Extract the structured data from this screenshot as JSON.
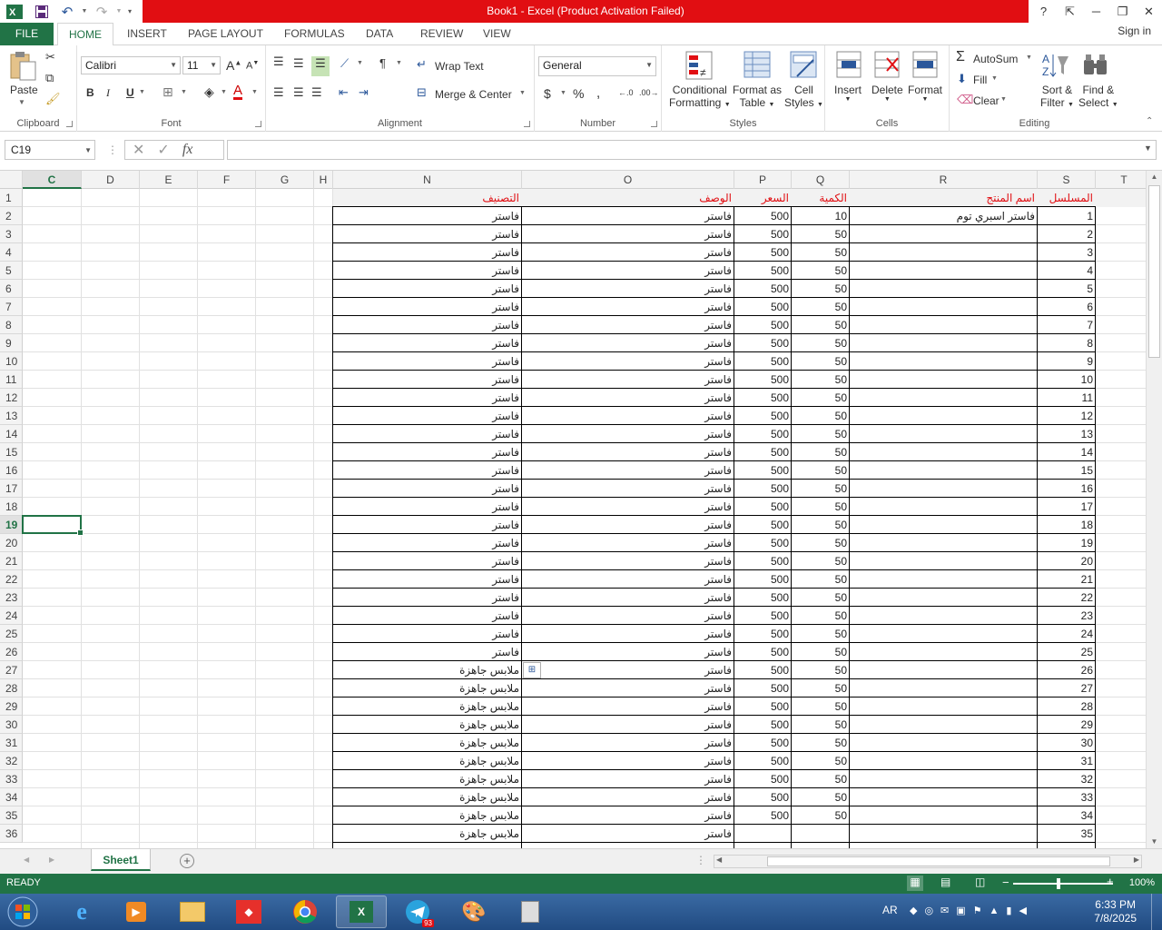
{
  "titlebar": {
    "title": "Book1 -  Excel (Product Activation Failed)",
    "help": "?"
  },
  "ribbon_tabs": {
    "file": "FILE",
    "tabs": [
      "HOME",
      "INSERT",
      "PAGE LAYOUT",
      "FORMULAS",
      "DATA",
      "REVIEW",
      "VIEW"
    ],
    "signin": "Sign in"
  },
  "ribbon": {
    "clipboard": {
      "paste": "Paste",
      "label": "Clipboard"
    },
    "font": {
      "name": "Calibri",
      "size": "11",
      "label": "Font",
      "bold": "B",
      "italic": "I",
      "underline": "U",
      "grow": "A",
      "shrink": "A"
    },
    "alignment": {
      "wrap_text": "Wrap Text",
      "merge_center": "Merge & Center",
      "label": "Alignment"
    },
    "number": {
      "format": "General",
      "currency": "$",
      "percent": "%",
      "comma": ",",
      "label": "Number"
    },
    "styles": {
      "conditional": "Conditional",
      "formatting": "Formatting",
      "format_as": "Format as",
      "table": "Table",
      "cell": "Cell",
      "cell_styles": "Styles",
      "label": "Styles"
    },
    "cells": {
      "insert": "Insert",
      "delete": "Delete",
      "format": "Format",
      "label": "Cells"
    },
    "editing": {
      "autosum": "AutoSum",
      "fill": "Fill",
      "clear": "Clear",
      "sort": "Sort &",
      "filter": "Filter",
      "find": "Find &",
      "select": "Select",
      "label": "Editing"
    }
  },
  "formula_bar": {
    "name_box": "C19",
    "fx": "fx",
    "content": ""
  },
  "columns": [
    "C",
    "D",
    "E",
    "F",
    "G",
    "H",
    "N",
    "O",
    "P",
    "Q",
    "R",
    "S",
    "T"
  ],
  "selected_column": "C",
  "selected_row": 19,
  "rows": [
    1,
    2,
    3,
    4,
    5,
    6,
    7,
    8,
    9,
    10,
    11,
    12,
    13,
    14,
    15,
    16,
    17,
    18,
    19,
    20,
    21,
    22,
    23,
    24,
    25,
    26,
    27,
    28,
    29,
    30,
    31,
    32,
    33,
    34,
    35,
    36
  ],
  "table": {
    "headers": {
      "S": "المسلسل",
      "R": "اسم المنتج",
      "Q": "الكمية",
      "P": "السعر",
      "O": "الوصف",
      "N": "التصنيف"
    },
    "first_row_product": "فاستر اسبري توم",
    "default_description": "فاستر",
    "categories": [
      "فاستر",
      "ملابس جاهزة"
    ],
    "category_switch_row": 27,
    "price": "500",
    "qty_first": "10",
    "qty_rest": "50",
    "last_priced_row": 35
  },
  "sheet_tabs": {
    "active": "Sheet1",
    "add": "+"
  },
  "statusbar": {
    "status": "READY",
    "zoom": "100%"
  },
  "taskbar": {
    "lang": "AR",
    "time": "6:33 PM",
    "date": "7/8/2025",
    "telegram_badge": "93"
  },
  "colors": {
    "excel_green": "#217346",
    "title_red": "#e10e12",
    "header_text": "#e10e12"
  }
}
